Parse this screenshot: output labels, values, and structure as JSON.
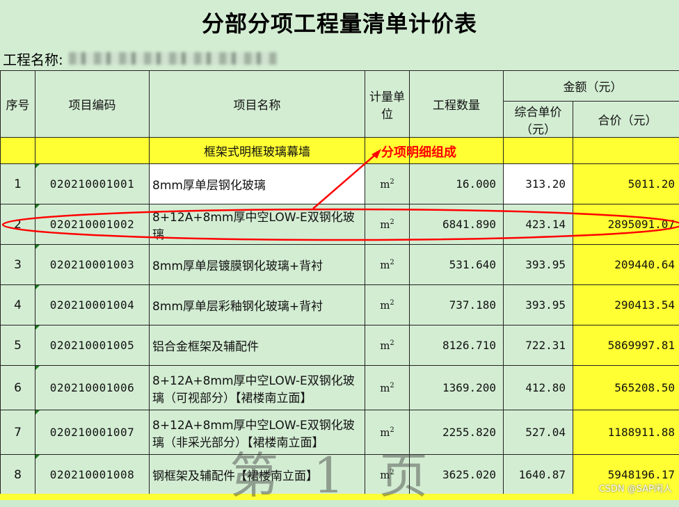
{
  "title": "分部分项工程量清单计价表",
  "project": {
    "label": "工程名称:"
  },
  "headers": {
    "no": "序号",
    "code": "项目编码",
    "name": "项目名称",
    "unit": "计量单位",
    "qty": "工程数量",
    "amount": "金额（元）",
    "unit_price": "综合单价（元）",
    "total": "合价（元）"
  },
  "section": "框架式明框玻璃幕墙",
  "annotation": "分项明细组成",
  "unit_symbol": "m",
  "unit_exp": "2",
  "rows": [
    {
      "no": "1",
      "code": "020210001001",
      "name": "8mm厚单层钢化玻璃",
      "qty": "16.000",
      "price": "313.20",
      "total": "5011.20"
    },
    {
      "no": "2",
      "code": "020210001002",
      "name": "8+12A+8mm厚中空LOW-E双钢化玻璃",
      "qty": "6841.890",
      "price": "423.14",
      "total": "2895091.07"
    },
    {
      "no": "3",
      "code": "020210001003",
      "name": "8mm厚单层镀膜钢化玻璃+背衬",
      "qty": "531.640",
      "price": "393.95",
      "total": "209440.64"
    },
    {
      "no": "4",
      "code": "020210001004",
      "name": "8mm厚单层彩釉钢化玻璃+背衬",
      "qty": "737.180",
      "price": "393.95",
      "total": "290413.54"
    },
    {
      "no": "5",
      "code": "020210001005",
      "name": "铝合金框架及辅配件",
      "qty": "8126.710",
      "price": "722.31",
      "total": "5869997.81"
    },
    {
      "no": "6",
      "code": "020210001006",
      "name": "8+12A+8mm厚中空LOW-E双钢化玻璃（可视部分）【裙楼南立面】",
      "qty": "1369.200",
      "price": "412.80",
      "total": "565208.50"
    },
    {
      "no": "7",
      "code": "020210001007",
      "name": "8+12A+8mm厚中空LOW-E双钢化玻璃（非采光部分）【裙楼南立面】",
      "qty": "2255.820",
      "price": "527.04",
      "total": "1188911.88"
    },
    {
      "no": "8",
      "code": "020210001008",
      "name": "钢框架及辅配件【裙楼南立面】",
      "qty": "3625.020",
      "price": "1640.87",
      "total": "5948196.17"
    }
  ],
  "watermark": "第 1 页",
  "credit": "CSDN @SAP闲人",
  "colors": {
    "highlight": "#ffff33",
    "background": "#d3edd3",
    "annotation": "#ff0000"
  }
}
